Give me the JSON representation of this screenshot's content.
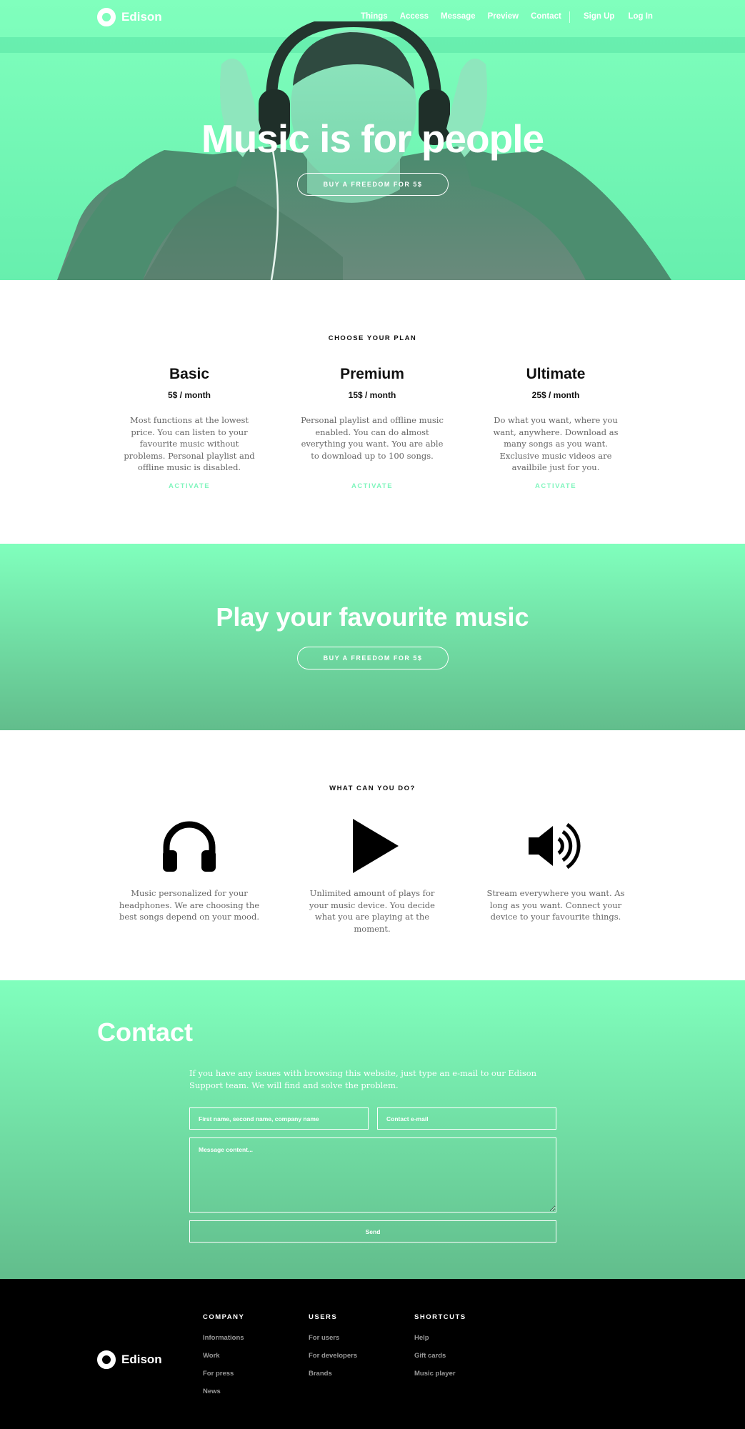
{
  "brand": {
    "name": "Edison"
  },
  "nav": {
    "items": [
      "Things",
      "Access",
      "Message",
      "Preview",
      "Contact"
    ],
    "signup": "Sign Up",
    "login": "Log In"
  },
  "hero": {
    "title": "Music is for people",
    "cta": "BUY A FREEDOM FOR 5$"
  },
  "plans": {
    "label": "CHOOSE YOUR PLAN",
    "items": [
      {
        "name": "Basic",
        "price": "5$ / month",
        "desc": "Most functions at the lowest price. You can listen to your favourite music without problems. Personal playlist and offline music is disabled.",
        "action": "ACTIVATE"
      },
      {
        "name": "Premium",
        "price": "15$ / month",
        "desc": "Personal playlist and offline music enabled. You can do almost everything you want. You are able to download up to 100 songs.",
        "action": "ACTIVATE"
      },
      {
        "name": "Ultimate",
        "price": "25$ / month",
        "desc": "Do what you want, where you want, anywhere. Download as many songs as you want. Exclusive music videos are availbile just for you.",
        "action": "ACTIVATE"
      }
    ]
  },
  "band": {
    "title": "Play your favourite music",
    "cta": "BUY A FREEDOM FOR 5$"
  },
  "features": {
    "label": "WHAT CAN YOU DO?",
    "items": [
      {
        "icon": "headphones-icon",
        "desc": "Music personalized for your headphones. We are choosing the best songs depend on your mood."
      },
      {
        "icon": "play-icon",
        "desc": "Unlimited amount of plays for your music device. You decide what you are playing at the moment."
      },
      {
        "icon": "speaker-icon",
        "desc": "Stream everywhere you want. As long as you want. Connect your device to your favourite things."
      }
    ]
  },
  "contact": {
    "title": "Contact",
    "intro": "If you have any issues with browsing this website, just type an e-mail to our Edison Support team. We will find and solve the problem.",
    "name_placeholder": "First name, second name, company name",
    "email_placeholder": "Contact e-mail",
    "message_placeholder": "Message content...",
    "send": "Send"
  },
  "footer": {
    "columns": [
      {
        "title": "COMPANY",
        "links": [
          "Informations",
          "Work",
          "For press",
          "News"
        ]
      },
      {
        "title": "USERS",
        "links": [
          "For users",
          "For developers",
          "Brands"
        ]
      },
      {
        "title": "SHORTCUTS",
        "links": [
          "Help",
          "Gift cards",
          "Music player"
        ]
      }
    ]
  },
  "colors": {
    "accent": "#80ffbd",
    "accent_dark": "#62bd8c",
    "footer_bg": "#000000"
  }
}
